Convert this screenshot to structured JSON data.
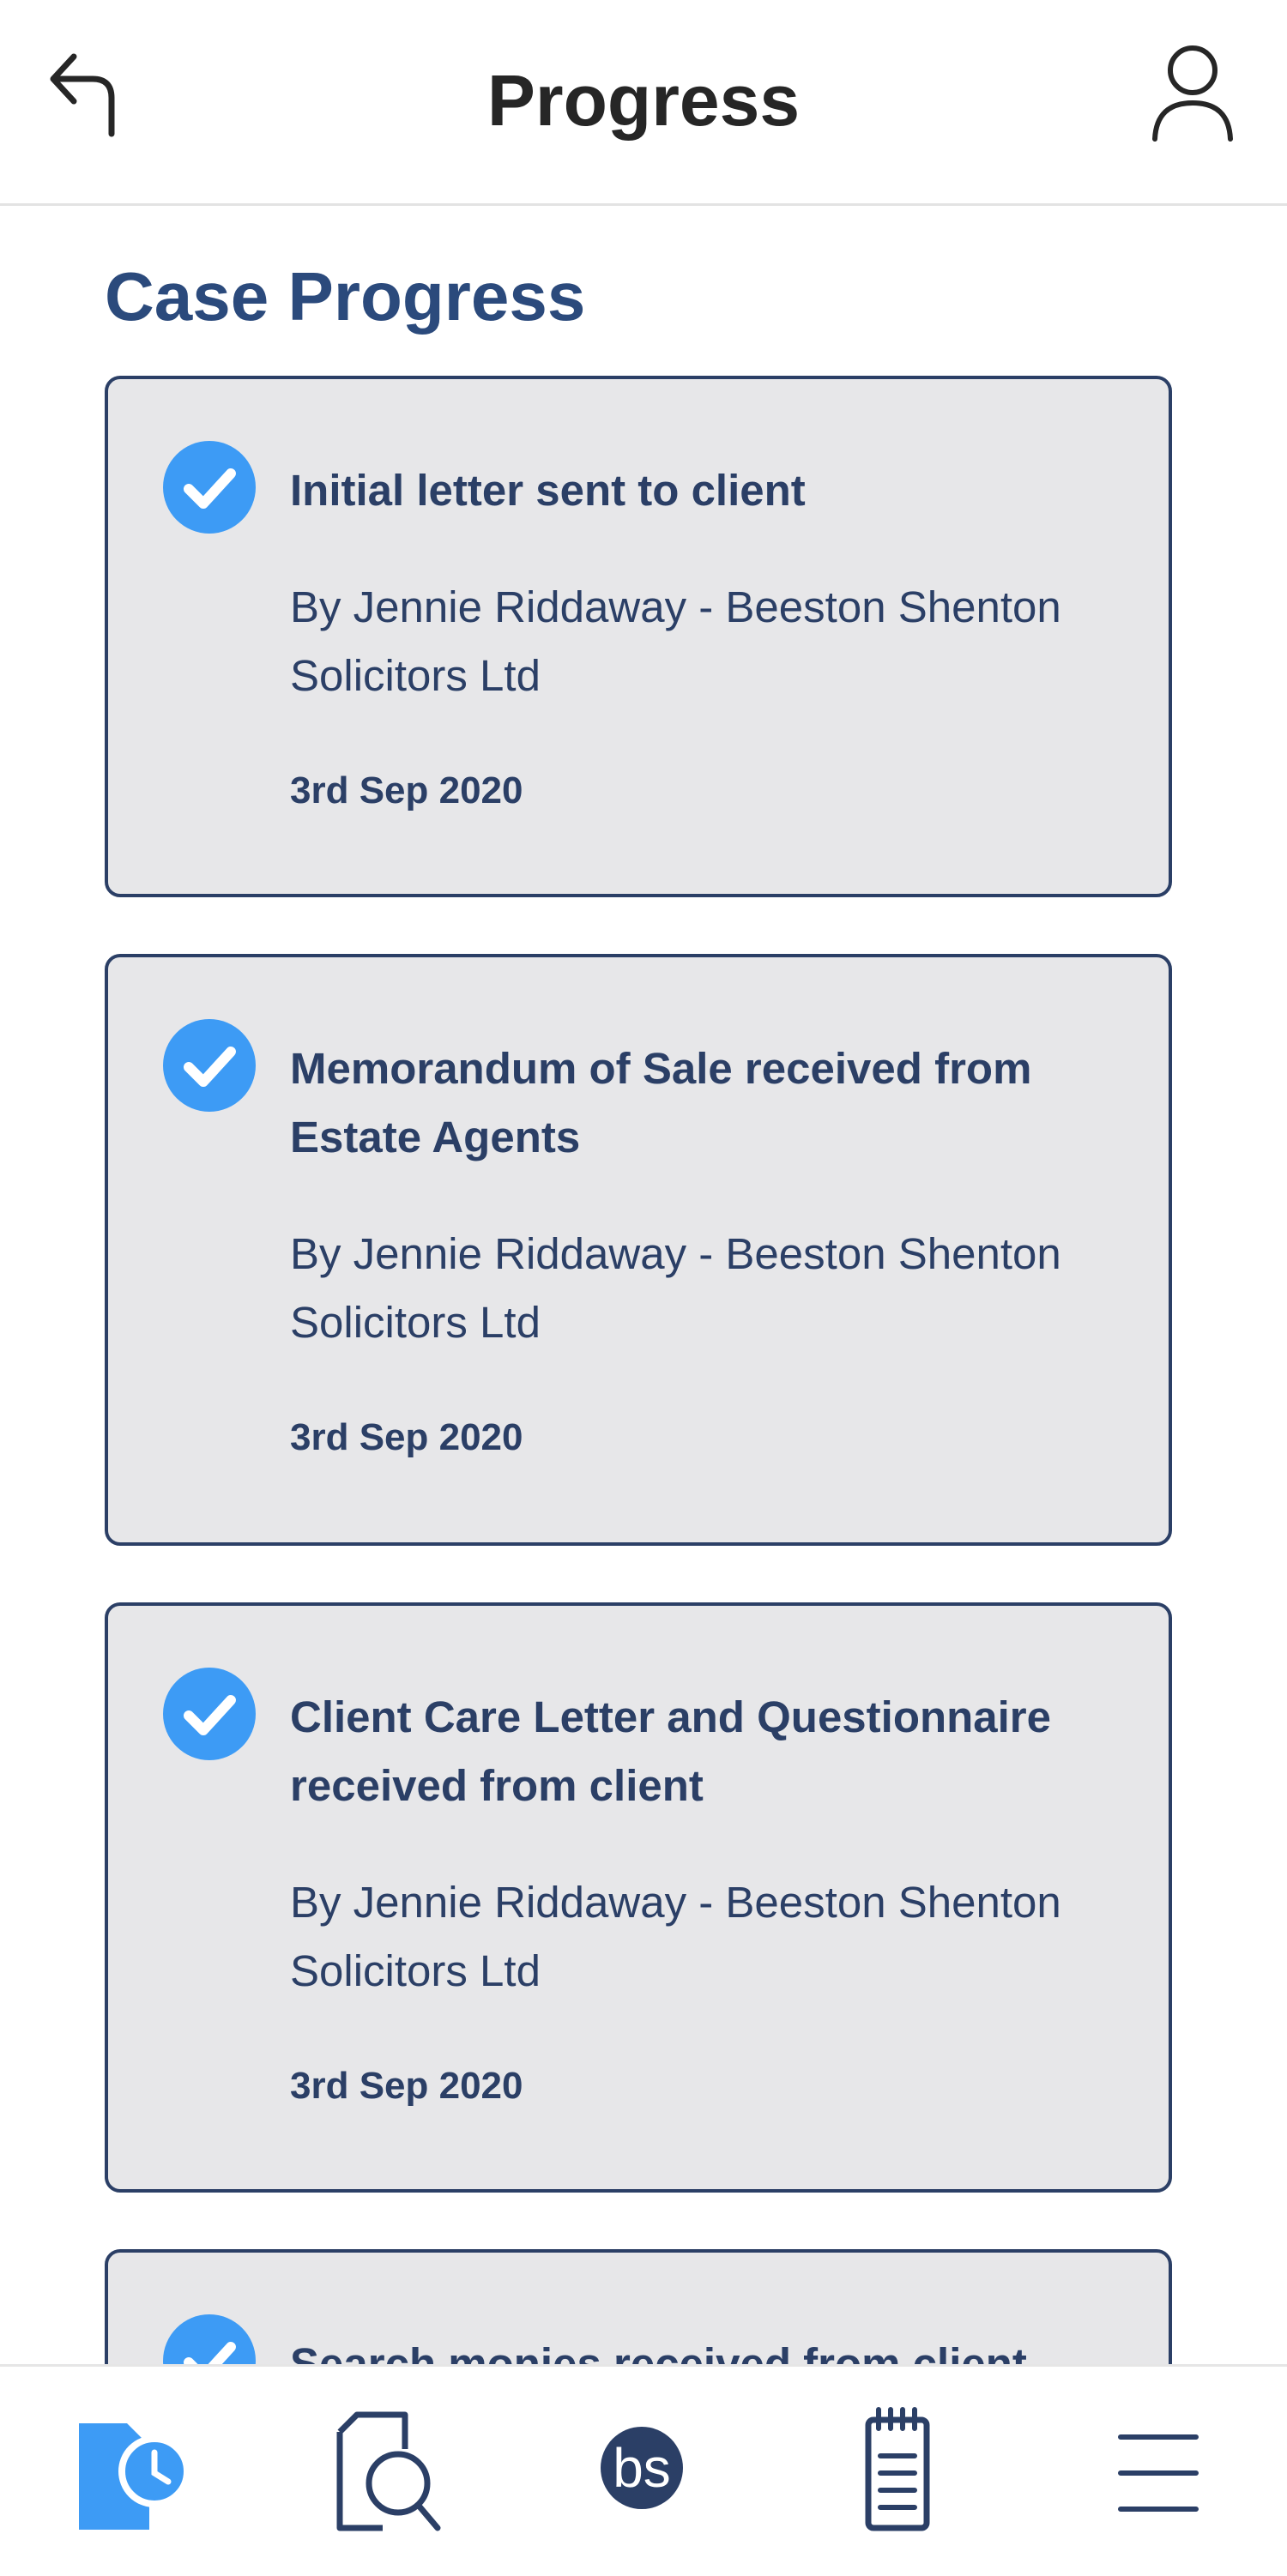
{
  "header": {
    "title": "Progress",
    "back_icon": "back-arrow-icon",
    "profile_icon": "user-icon"
  },
  "main": {
    "section_title": "Case Progress",
    "items": [
      {
        "title": "Initial letter sent to client",
        "by": "By Jennie Riddaway - Beeston Shenton Solicitors Ltd",
        "date": "3rd Sep 2020",
        "status_icon": "check-circle-icon"
      },
      {
        "title": "Memorandum of Sale received from Estate Agents",
        "by": "By Jennie Riddaway - Beeston Shenton Solicitors Ltd",
        "date": "3rd Sep 2020",
        "status_icon": "check-circle-icon"
      },
      {
        "title": "Client Care Letter and Questionnaire received from client",
        "by": "By Jennie Riddaway - Beeston Shenton Solicitors Ltd",
        "date": "3rd Sep 2020",
        "status_icon": "check-circle-icon"
      },
      {
        "title": "Search monies received from client",
        "status_icon": "check-circle-icon"
      }
    ]
  },
  "bottom_nav": {
    "items": [
      {
        "icon": "progress-document-clock-icon",
        "active": true
      },
      {
        "icon": "document-search-icon",
        "active": false
      },
      {
        "icon": "bs-logo-icon",
        "label": "bs",
        "active": false
      },
      {
        "icon": "notepad-icon",
        "active": false
      },
      {
        "icon": "menu-icon",
        "active": false
      }
    ]
  },
  "colors": {
    "accent": "#3d9bf5",
    "primary_text": "#2b3f66",
    "card_background": "#e7e7e9",
    "title_text": "#262626"
  }
}
